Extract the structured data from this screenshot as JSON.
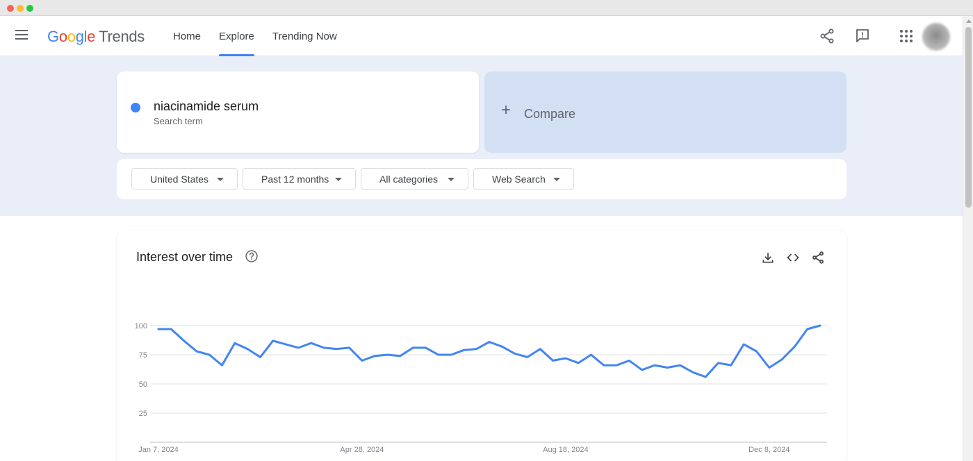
{
  "app": {
    "logo_google_letters": [
      "G",
      "o",
      "o",
      "g",
      "l",
      "e"
    ],
    "logo_product": "Trends"
  },
  "nav": [
    {
      "label": "Home"
    },
    {
      "label": "Explore",
      "active": true
    },
    {
      "label": "Trending Now"
    }
  ],
  "header_icons": [
    "share-icon",
    "feedback-icon",
    "apps-grid-icon",
    "account-avatar"
  ],
  "search": {
    "term": "niacinamide serum",
    "subtitle": "Search term",
    "term_color": "#4285f4"
  },
  "compare": {
    "plus": "+",
    "label": "Compare"
  },
  "filters": [
    {
      "label": "United States"
    },
    {
      "label": "Past 12 months"
    },
    {
      "label": "All categories"
    },
    {
      "label": "Web Search"
    }
  ],
  "chart_card": {
    "title": "Interest over time",
    "icons": [
      "help-icon",
      "download-icon",
      "embed-code-icon",
      "share-icon"
    ]
  },
  "chart_data": {
    "type": "line",
    "title": "Interest over time",
    "xlabel": "",
    "ylabel": "",
    "ylim": [
      0,
      100
    ],
    "yticks": [
      25,
      50,
      75,
      100
    ],
    "xtick_labels": [
      {
        "label": "Jan 7, 2024",
        "index": 0
      },
      {
        "label": "Apr 28, 2024",
        "index": 16
      },
      {
        "label": "Aug 18, 2024",
        "index": 32
      },
      {
        "label": "Dec 8, 2024",
        "index": 48
      }
    ],
    "grid": true,
    "series": [
      {
        "color": "#4285f4",
        "values": [
          97,
          97,
          87,
          78,
          75,
          66,
          85,
          80,
          73,
          87,
          84,
          81,
          85,
          81,
          80,
          81,
          70,
          74,
          75,
          74,
          81,
          81,
          75,
          75,
          79,
          80,
          86,
          82,
          76,
          73,
          80,
          70,
          72,
          68,
          75,
          66,
          66,
          70,
          62,
          66,
          64,
          66,
          60,
          56,
          68,
          66,
          84,
          78,
          64,
          71,
          82,
          97,
          100
        ]
      }
    ]
  }
}
